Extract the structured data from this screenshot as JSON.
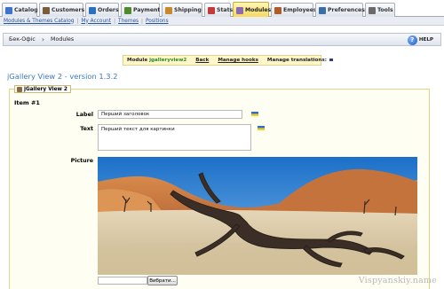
{
  "tabs": [
    {
      "label": "Catalog",
      "color": "#3c74c9"
    },
    {
      "label": "Customers",
      "color": "#7a5d3a"
    },
    {
      "label": "Orders",
      "color": "#2c6fbf"
    },
    {
      "label": "Payment",
      "color": "#4f8a2f"
    },
    {
      "label": "Shipping",
      "color": "#c78a2a"
    },
    {
      "label": "Stats",
      "color": "#c23a3a"
    },
    {
      "label": "Modules",
      "color": "#8c6ab3",
      "active": true
    },
    {
      "label": "Employees",
      "color": "#b05b2a"
    },
    {
      "label": "Preferences",
      "color": "#3b6ea8"
    },
    {
      "label": "Tools",
      "color": "#6a6a6a"
    }
  ],
  "submenu": [
    "Modules & Themes Catalog",
    "My Account",
    "Themes",
    "Positions"
  ],
  "breadcrumb": {
    "home": "Бек-Офіс",
    "current": "Modules"
  },
  "help_label": "HELP",
  "module_toolbar": {
    "module_prefix": "Module",
    "module_name": "jgalleryview2",
    "back": "Back",
    "manage_hooks": "Manage hooks",
    "manage_translations": "Manage translations:"
  },
  "page_title": "jGallery View 2 - version 1.3.2",
  "fieldset_legend": "jGallery View 2",
  "item_title": "Item #1",
  "form": {
    "label_caption": "Label",
    "label_value": "Перший заголовок",
    "text_caption": "Text",
    "text_value": "Перший текст для картинки",
    "picture_caption": "Picture",
    "browse_button": "Вибрати..."
  },
  "watermark": "Vispyanskiy.name"
}
